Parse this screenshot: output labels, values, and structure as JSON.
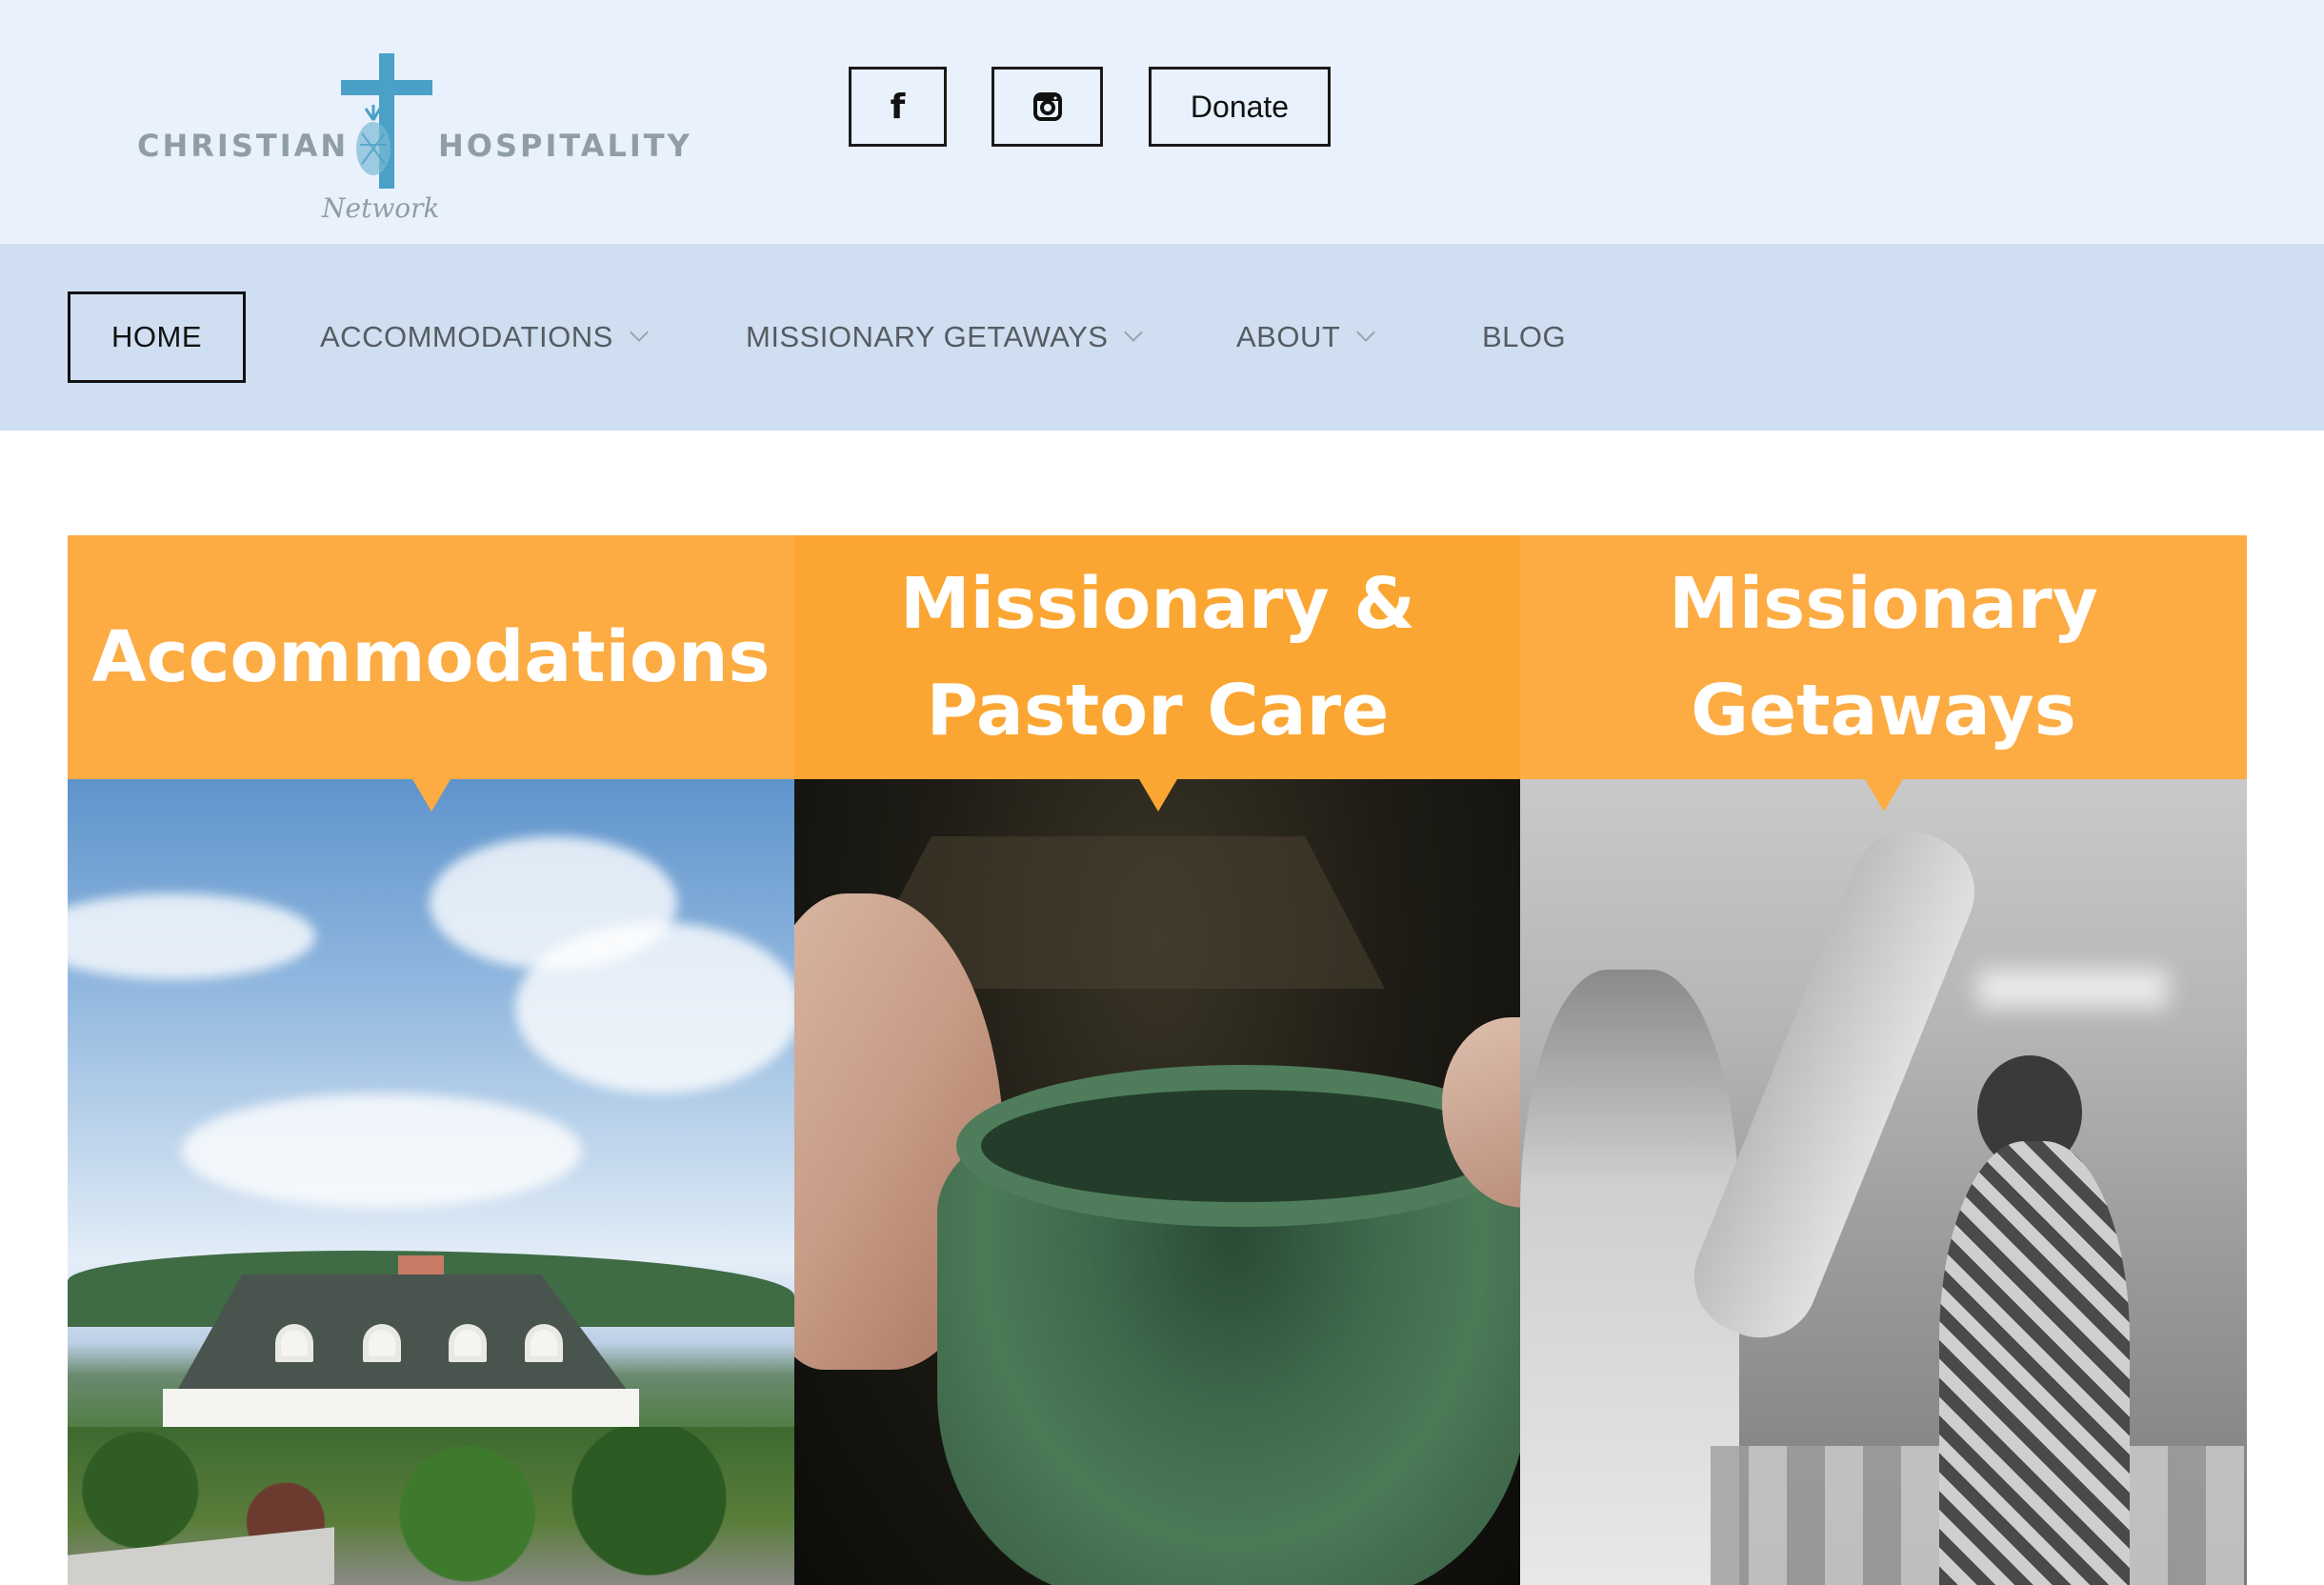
{
  "brand": {
    "word_left": "CHRISTIAN",
    "word_right": "HOSPITALITY",
    "subtitle": "Network",
    "colors": {
      "cross": "#4aa0c6",
      "text": "#8f9ea3"
    }
  },
  "header": {
    "social": [
      {
        "name": "facebook",
        "label": "f",
        "icon": "facebook-icon"
      },
      {
        "name": "instagram",
        "icon": "instagram-icon"
      }
    ],
    "donate_label": "Donate"
  },
  "nav": {
    "items": [
      {
        "label": "HOME",
        "active": true,
        "dropdown": false
      },
      {
        "label": "ACCOMMODATIONS",
        "active": false,
        "dropdown": true
      },
      {
        "label": "MISSIONARY GETAWAYS",
        "active": false,
        "dropdown": true
      },
      {
        "label": "ABOUT",
        "active": false,
        "dropdown": true
      },
      {
        "label": "BLOG",
        "active": false,
        "dropdown": false
      }
    ]
  },
  "cards": [
    {
      "title_lines": [
        "Accommodations"
      ],
      "image": "house-with-sky-photo"
    },
    {
      "title_lines": [
        "Missionary &",
        "Pastor Care"
      ],
      "image": "green-mug-in-hands-photo"
    },
    {
      "title_lines": [
        "Missionary",
        "Getaways"
      ],
      "image": "worship-gathering-photo"
    }
  ],
  "colors": {
    "header_bg": "#e9f1fc",
    "nav_bg": "#cfdff1",
    "banner_orange": "#fdab43",
    "banner_orange_dark": "#fba632"
  }
}
